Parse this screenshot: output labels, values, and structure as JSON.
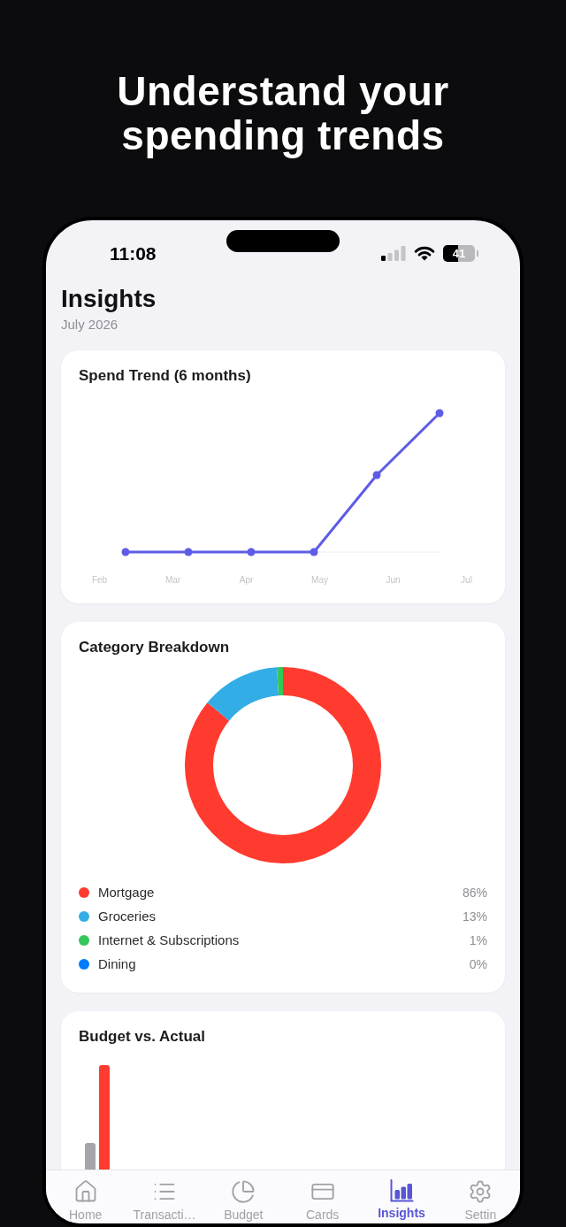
{
  "headline": "Understand your spending trends",
  "status_bar": {
    "time": "11:08",
    "battery": "41"
  },
  "header": {
    "title": "Insights",
    "subtitle": "July 2026"
  },
  "spend_trend": {
    "title": "Spend Trend (6 months)",
    "x_labels": [
      "Feb",
      "Mar",
      "Apr",
      "May",
      "Jun",
      "Jul"
    ]
  },
  "category_breakdown": {
    "chart_data": {
      "type": "donut",
      "title": "Category Breakdown",
      "categories": [
        "Mortgage",
        "Groceries",
        "Internet & Subscriptions",
        "Dining"
      ],
      "values": [
        86,
        13,
        1,
        0
      ]
    },
    "legend": [
      {
        "share": "86%",
        "color": "#ff3b30"
      },
      {
        "share": "13%",
        "color": "#32ade6"
      },
      {
        "share": "1%",
        "color": "#34c759"
      },
      {
        "share": "0%",
        "color": "#007aff"
      }
    ]
  },
  "budget_vs_actual": {
    "title": "Budget vs. Actual"
  },
  "tab_bar": [
    {
      "label": "Home",
      "selected": false
    },
    {
      "label": "Transacti…",
      "selected": false
    },
    {
      "label": "Budget",
      "selected": false
    },
    {
      "label": "Cards",
      "selected": false
    },
    {
      "label": "Insights",
      "selected": true
    },
    {
      "label": "Settin",
      "selected": false
    }
  ]
}
